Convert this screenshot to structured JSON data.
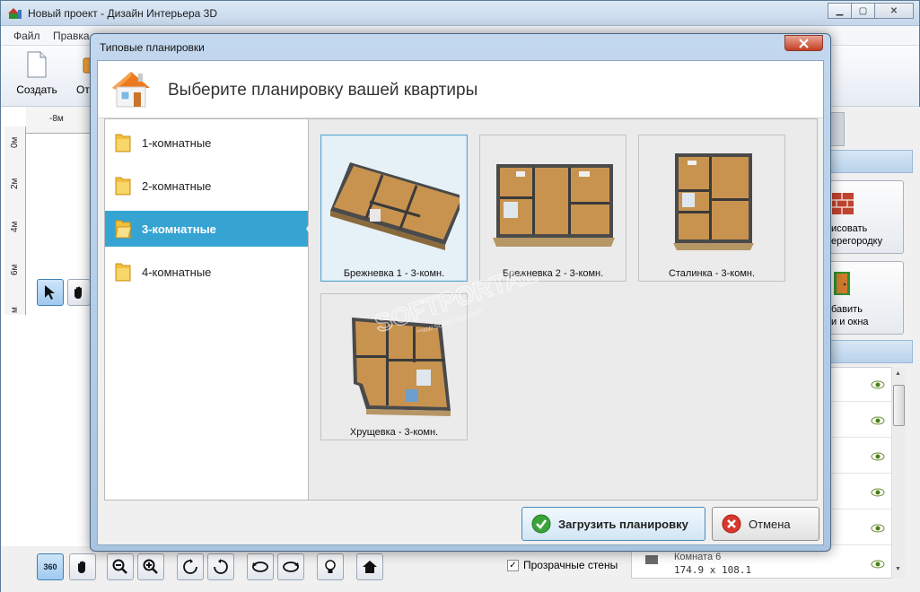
{
  "window": {
    "title": "Новый проект - Дизайн Интерьера 3D",
    "minimize": "▁",
    "maximize": "▢",
    "close": "✕"
  },
  "menu": [
    "Файл",
    "Правка"
  ],
  "ribbon": {
    "create_label": "Создать",
    "open_label_partial": "Отк"
  },
  "rulers": {
    "top": [
      "-8м"
    ],
    "left": [
      "0м",
      "2м",
      "4м",
      "6м",
      "м"
    ]
  },
  "bottom_toolbar": {
    "rotate360_label": "360",
    "transparent_walls_label": "Прозрачные стены",
    "transparent_walls_checked": true
  },
  "right_panel": {
    "draw_partition_lines": [
      "исовать",
      "ерегородку"
    ],
    "add_doors_lines": [
      "бавить",
      "и и окна"
    ],
    "room_item": {
      "name": "Комната 6",
      "size": "174.9 x 108.1"
    }
  },
  "dialog": {
    "title": "Типовые планировки",
    "heading": "Выберите планировку вашей квартиры",
    "categories": [
      {
        "label": "1-комнатные",
        "selected": false
      },
      {
        "label": "2-комнатные",
        "selected": false
      },
      {
        "label": "3-комнатные",
        "selected": true
      },
      {
        "label": "4-комнатные",
        "selected": false
      }
    ],
    "layouts": [
      {
        "caption": "Брежневка 1 - 3-комн.",
        "selected": true
      },
      {
        "caption": "Брежневка 2 - 3-комн.",
        "selected": false
      },
      {
        "caption": "Сталинка - 3-комн.",
        "selected": false
      },
      {
        "caption": "Хрущевка - 3-комн.",
        "selected": false
      }
    ],
    "load_button": "Загрузить планировку",
    "cancel_button": "Отмена"
  },
  "watermark": {
    "brand": "SOFTPORTAL",
    "url": "www.softportal.com",
    "tm": "™"
  },
  "colors": {
    "selected_category": "#35a4d3",
    "dialog_frame": "#a9c4e1",
    "accent_green": "#3aa33a",
    "accent_red": "#d8382a"
  }
}
